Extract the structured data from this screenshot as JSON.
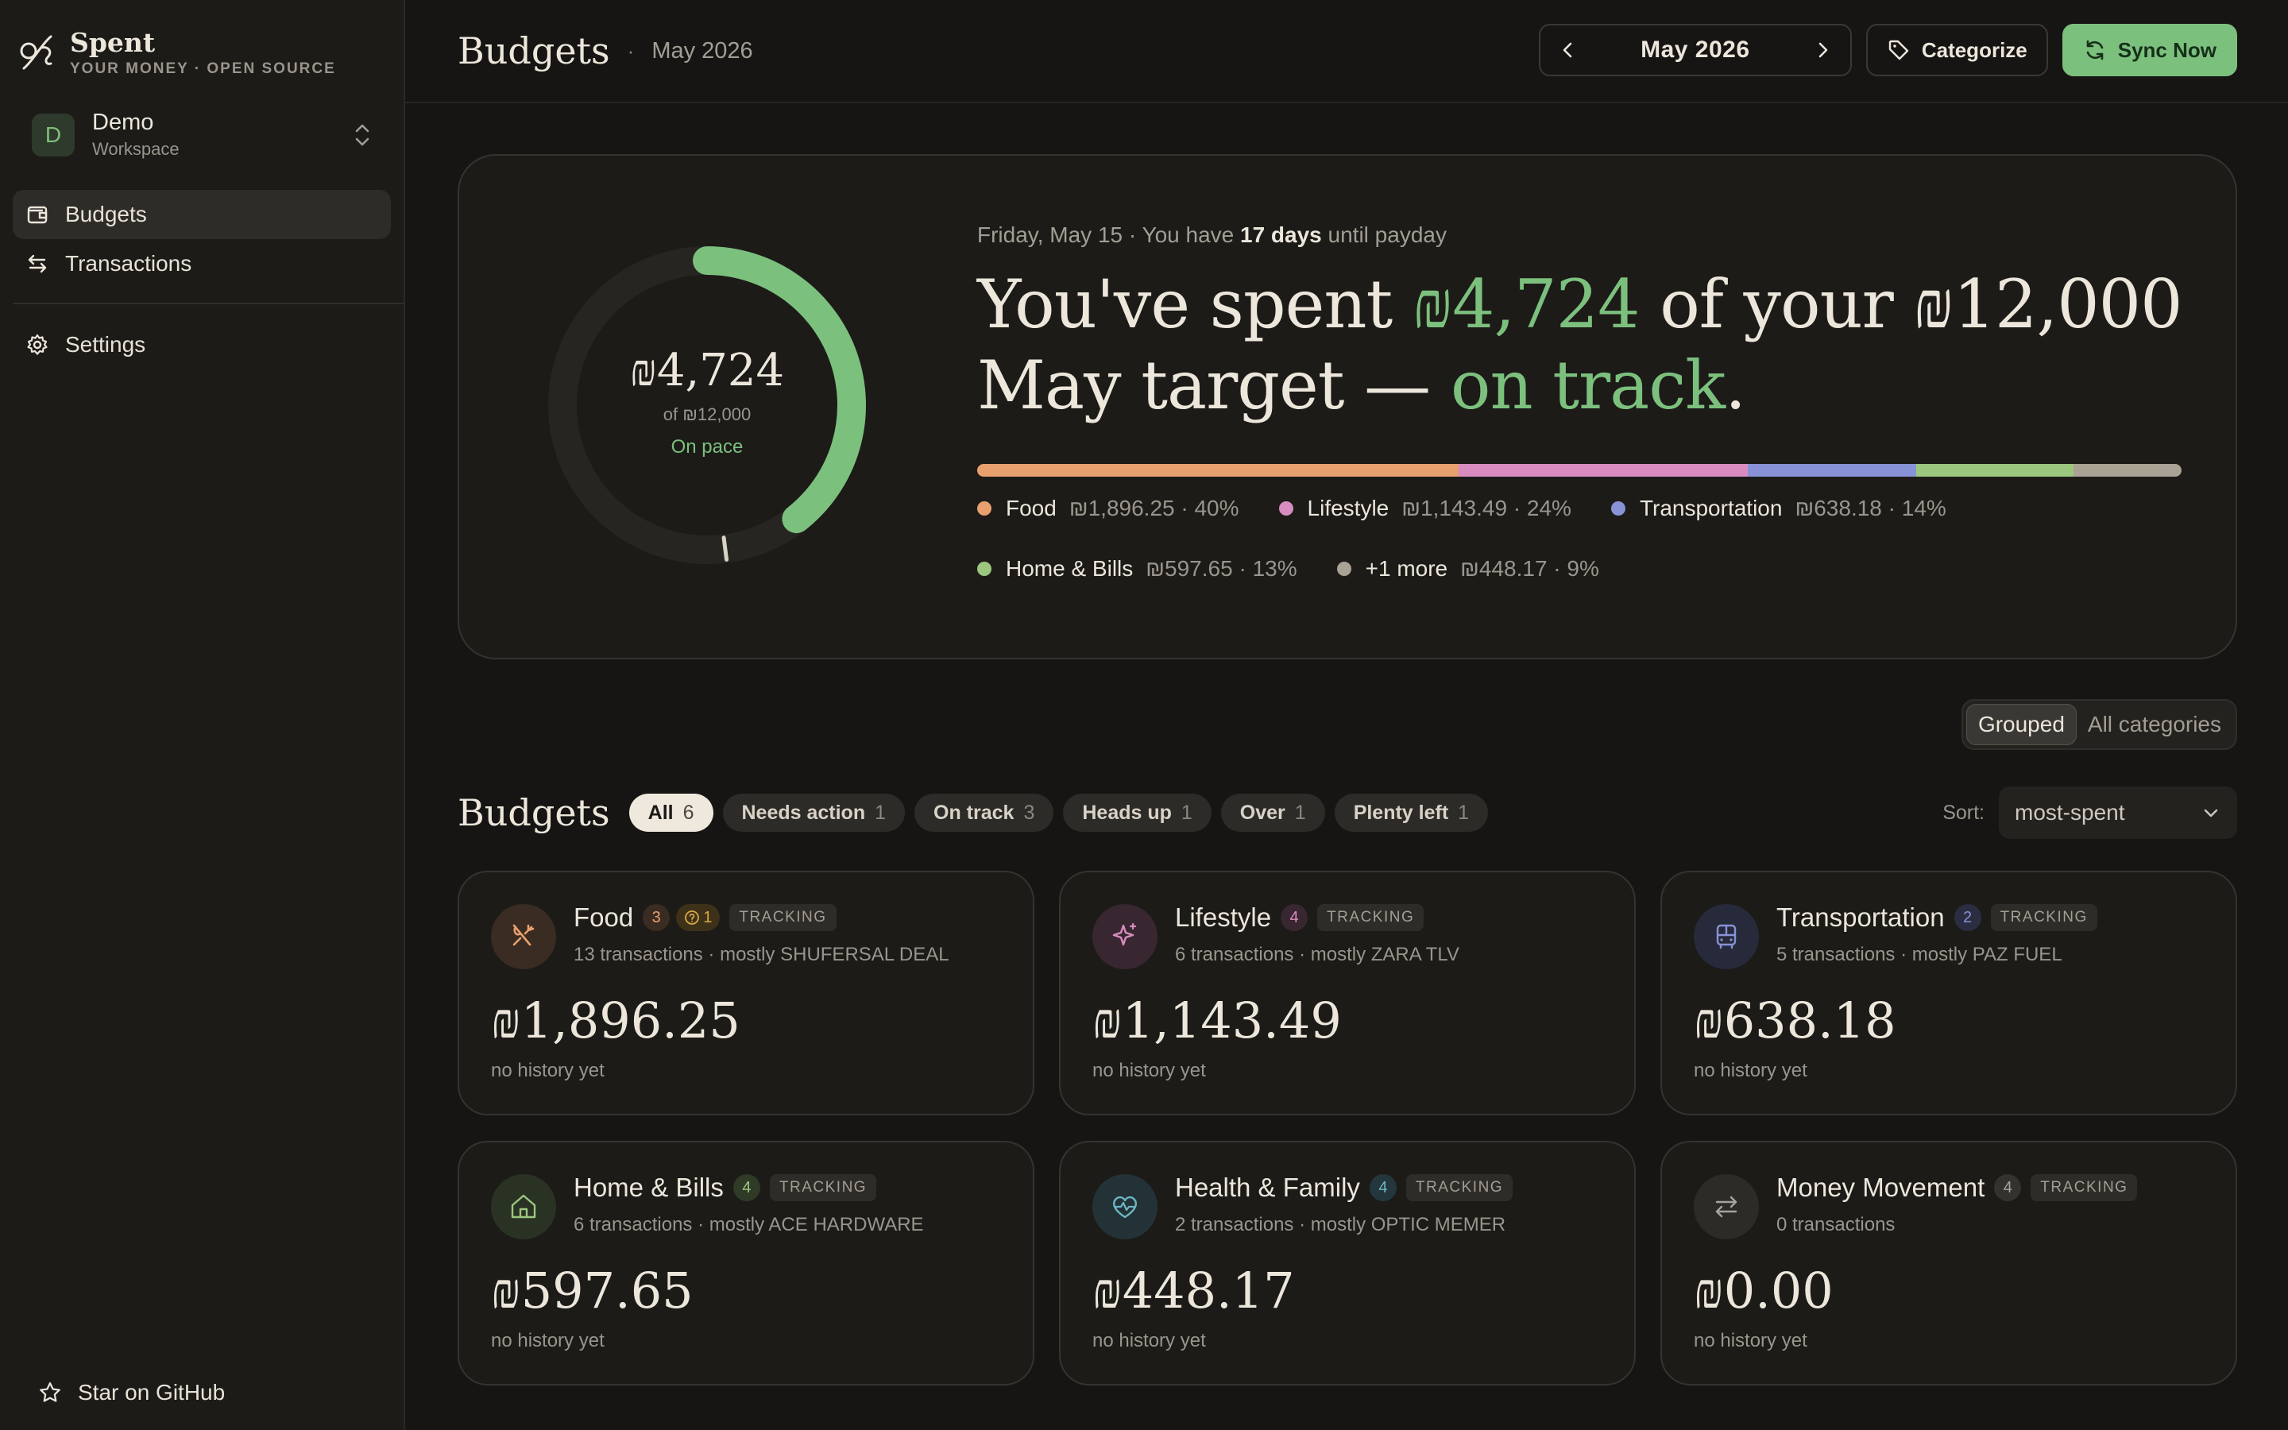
{
  "brand": {
    "name": "Spent",
    "tagline": "YOUR MONEY · OPEN SOURCE"
  },
  "workspace": {
    "initial": "D",
    "name": "Demo",
    "subtitle": "Workspace"
  },
  "nav": {
    "budgets": "Budgets",
    "transactions": "Transactions",
    "settings": "Settings",
    "github": "Star on GitHub"
  },
  "header": {
    "title": "Budgets",
    "month": "May 2026",
    "nav_month": "May 2026",
    "categorize": "Categorize",
    "sync": "Sync Now"
  },
  "hero": {
    "ring": {
      "amount": "₪4,724",
      "of": "of ₪12,000",
      "status": "On pace",
      "progress": 0.394,
      "pace_marker": 0.48
    },
    "date_prefix": "Friday, May 15 · You have",
    "days": "17 days",
    "date_suffix": "until payday",
    "headline": {
      "p1": "You've spent",
      "spent": "₪4,724",
      "p2": "of your",
      "target": "₪12,000",
      "p3": "May target —",
      "status": "on track",
      "p4": "."
    },
    "breakdown": [
      {
        "name": "Food",
        "value": "₪1,896.25 · 40%",
        "share": 40,
        "color": "#e8a06e"
      },
      {
        "name": "Lifestyle",
        "value": "₪1,143.49 · 24%",
        "share": 24,
        "color": "#d98cbf"
      },
      {
        "name": "Transportation",
        "value": "₪638.18 · 14%",
        "share": 14,
        "color": "#8892d6"
      },
      {
        "name": "Home & Bills",
        "value": "₪597.65 · 13%",
        "share": 13,
        "color": "#9cc77e"
      },
      {
        "name": "+1 more",
        "value": "₪448.17 · 9%",
        "share": 9,
        "color": "#aaa294"
      }
    ]
  },
  "view_toggle": {
    "grouped": "Grouped",
    "all": "All categories"
  },
  "budgets_section": {
    "title": "Budgets",
    "filters": [
      {
        "label": "All",
        "count": "6"
      },
      {
        "label": "Needs action",
        "count": "1"
      },
      {
        "label": "On track",
        "count": "3"
      },
      {
        "label": "Heads up",
        "count": "1"
      },
      {
        "label": "Over",
        "count": "1"
      },
      {
        "label": "Plenty left",
        "count": "1"
      }
    ],
    "sort_label": "Sort:",
    "sort_value": "most-spent"
  },
  "cards": [
    {
      "title": "Food",
      "count": "3",
      "warning": "1",
      "tag": "TRACKING",
      "sub": "13 transactions · mostly SHUFERSAL DEAL",
      "amount": "₪1,896.25",
      "history": "no history yet",
      "icon": "utensils-icon",
      "accent": "#e8a06e",
      "icon_bg": "#3a2c22",
      "badge_bg": "#3a2c22"
    },
    {
      "title": "Lifestyle",
      "count": "4",
      "tag": "TRACKING",
      "sub": "6 transactions · mostly ZARA TLV",
      "amount": "₪1,143.49",
      "history": "no history yet",
      "icon": "sparkles-icon",
      "accent": "#d98cbf",
      "icon_bg": "#382630",
      "badge_bg": "#382630"
    },
    {
      "title": "Transportation",
      "count": "2",
      "tag": "TRACKING",
      "sub": "5 transactions · mostly PAZ FUEL",
      "amount": "₪638.18",
      "history": "no history yet",
      "icon": "bus-icon",
      "accent": "#8892d6",
      "icon_bg": "#272a3b",
      "badge_bg": "#2b2e42"
    },
    {
      "title": "Home & Bills",
      "count": "4",
      "tag": "TRACKING",
      "sub": "6 transactions · mostly ACE HARDWARE",
      "amount": "₪597.65",
      "history": "no history yet",
      "icon": "home-icon",
      "accent": "#9cc77e",
      "icon_bg": "#2a3224",
      "badge_bg": "#2f3a27"
    },
    {
      "title": "Health & Family",
      "count": "4",
      "tag": "TRACKING",
      "sub": "2 transactions · mostly OPTIC MEMER",
      "amount": "₪448.17",
      "history": "no history yet",
      "icon": "heart-pulse-icon",
      "accent": "#6cb6c4",
      "icon_bg": "#233236",
      "badge_bg": "#24373c"
    },
    {
      "title": "Money Movement",
      "count": "4",
      "tag": "TRACKING",
      "sub": "0 transactions",
      "amount": "₪0.00",
      "history": "no history yet",
      "icon": "arrows-icon",
      "accent": "#a8a39a",
      "icon_bg": "#2c2b28",
      "badge_bg": "#34322e"
    }
  ]
}
